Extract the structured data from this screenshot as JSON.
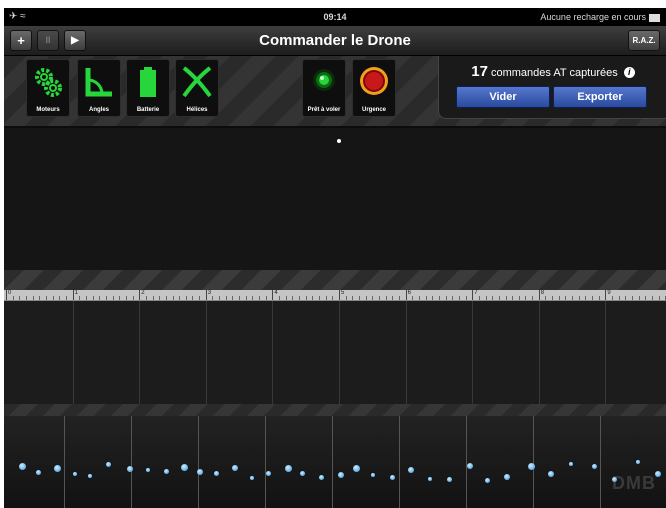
{
  "status_bar": {
    "airplane_icon": "airplane-icon",
    "time": "09:14",
    "charging_text": "Aucune recharge en cours"
  },
  "toolbar": {
    "add_label": "+",
    "pause_label": "II",
    "play_label": "▶",
    "title": "Commander le Drone",
    "raz_label": "R.A.Z."
  },
  "instruments": {
    "items": [
      {
        "label": "Moteurs",
        "icon": "gears-icon"
      },
      {
        "label": "Angles",
        "icon": "angle-icon"
      },
      {
        "label": "Batterie",
        "icon": "battery-icon"
      },
      {
        "label": "Hélices",
        "icon": "propeller-icon"
      }
    ],
    "ready_label": "Prêt à voler",
    "emergency_label": "Urgence",
    "colors": {
      "green": "#27d63a",
      "red": "#c8181a",
      "orange": "#f0a01a"
    }
  },
  "at_panel": {
    "count": "17",
    "count_text": "commandes AT capturées",
    "clear_label": "Vider",
    "export_label": "Exporter"
  },
  "ruler": {
    "labels": [
      "0",
      "1",
      "2",
      "3",
      "4",
      "5",
      "6",
      "7",
      "8",
      "9"
    ]
  },
  "watermark": "DMB"
}
